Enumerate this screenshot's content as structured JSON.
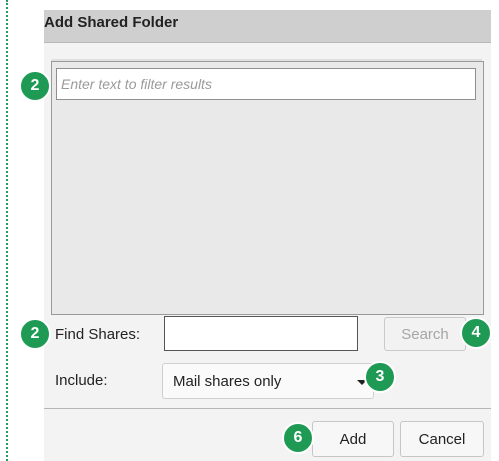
{
  "dialog": {
    "title": "Add Shared Folder"
  },
  "filter": {
    "placeholder": "Enter text to filter results"
  },
  "find": {
    "label": "Find Shares:",
    "value": "",
    "search_label": "Search"
  },
  "include": {
    "label": "Include:",
    "selected": "Mail shares only"
  },
  "actions": {
    "add_label": "Add",
    "cancel_label": "Cancel"
  },
  "callouts": {
    "filter": "2",
    "find": "2",
    "search": "4",
    "include": "3",
    "add": "6"
  },
  "colors": {
    "callout": "#1e9a54",
    "titlebar": "#cfcfcf"
  }
}
